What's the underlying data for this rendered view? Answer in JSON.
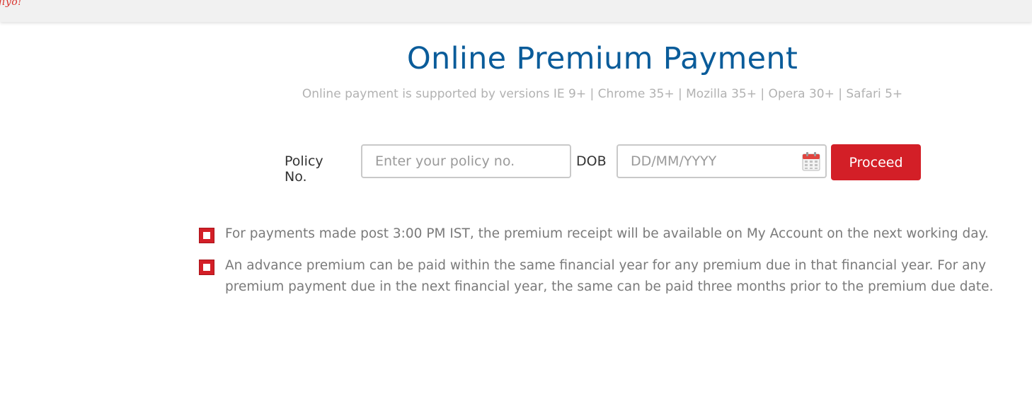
{
  "header": {
    "logo_text": "jiyo!"
  },
  "page": {
    "title": "Online Premium Payment",
    "subtitle": "Online payment is supported by versions IE 9+ | Chrome 35+ | Mozilla 35+ | Opera 30+ | Safari 5+"
  },
  "form": {
    "policy_label": "Policy No.",
    "policy_placeholder": "Enter your policy no.",
    "policy_value": "",
    "dob_label": "DOB",
    "dob_placeholder": "DD/MM/YYYY",
    "dob_value": "",
    "dob_icon": "calendar-icon",
    "proceed_label": "Proceed"
  },
  "notes": [
    "For payments made post 3:00 PM IST, the premium receipt will be available on My Account on the next working day.",
    "An advance premium can be paid within the same financial year for any premium due in that financial year. For any premium payment due in the next financial year, the same can be paid three months prior to the premium due date."
  ],
  "colors": {
    "title": "#0a5c9a",
    "accent": "#d31f27",
    "subtitle": "#b2b2b2",
    "note_text": "#7a7a7a"
  }
}
